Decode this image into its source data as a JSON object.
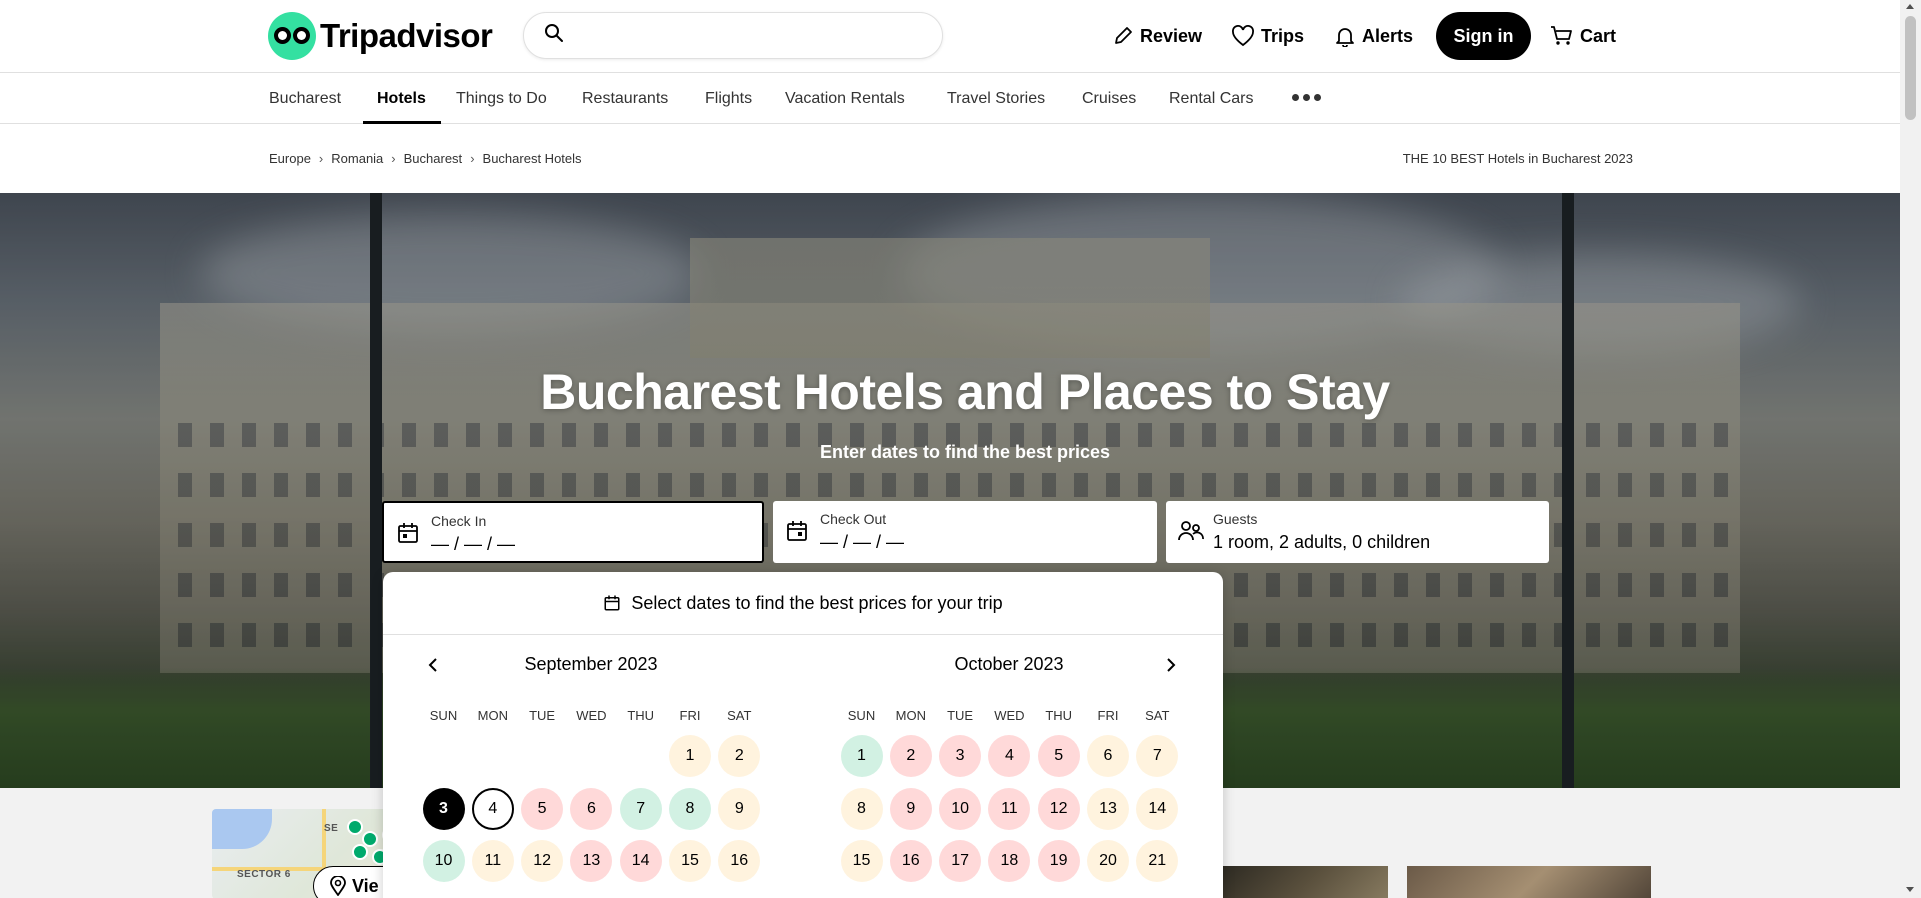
{
  "header": {
    "brand": "Tripadvisor",
    "search": {
      "value": "",
      "placeholder": ""
    },
    "nav": {
      "review": "Review",
      "trips": "Trips",
      "alerts": "Alerts",
      "signin": "Sign in",
      "cart": "Cart"
    }
  },
  "subnav": {
    "items": [
      "Bucharest",
      "Hotels",
      "Things to Do",
      "Restaurants",
      "Flights",
      "Vacation Rentals",
      "Travel Stories",
      "Cruises",
      "Rental Cars"
    ],
    "active": "Hotels"
  },
  "breadcrumbs": {
    "items": [
      "Europe",
      "Romania",
      "Bucharest",
      "Bucharest Hotels"
    ],
    "right_title": "THE 10 BEST Hotels in Bucharest 2023"
  },
  "hero": {
    "title": "Bucharest Hotels and Places to Stay",
    "subtitle": "Enter dates to find the best prices",
    "check_in": {
      "label": "Check In",
      "value": "— / — / —"
    },
    "check_out": {
      "label": "Check Out",
      "value": "— / — / —"
    },
    "guests": {
      "label": "Guests",
      "value": "1 room, 2 adults, 0 children"
    }
  },
  "calendar": {
    "header": "Select dates to find the best prices for your trip",
    "weekdays": [
      "SUN",
      "MON",
      "TUE",
      "WED",
      "THU",
      "FRI",
      "SAT"
    ],
    "price_colors": {
      "high": "#ffd9d9",
      "mid": "#fff3de",
      "low": "#d2f1e3",
      "selected": "#000000"
    },
    "months": [
      {
        "title": "September 2023",
        "weeks": [
          [
            null,
            null,
            null,
            null,
            null,
            {
              "d": "1",
              "t": "mid"
            },
            {
              "d": "2",
              "t": "mid"
            }
          ],
          [
            {
              "d": "3",
              "t": "sel"
            },
            {
              "d": "4",
              "t": "ring"
            },
            {
              "d": "5",
              "t": "high"
            },
            {
              "d": "6",
              "t": "high"
            },
            {
              "d": "7",
              "t": "low"
            },
            {
              "d": "8",
              "t": "low"
            },
            {
              "d": "9",
              "t": "mid"
            }
          ],
          [
            {
              "d": "10",
              "t": "low"
            },
            {
              "d": "11",
              "t": "mid"
            },
            {
              "d": "12",
              "t": "mid"
            },
            {
              "d": "13",
              "t": "high"
            },
            {
              "d": "14",
              "t": "high"
            },
            {
              "d": "15",
              "t": "mid"
            },
            {
              "d": "16",
              "t": "mid"
            }
          ]
        ]
      },
      {
        "title": "October 2023",
        "weeks": [
          [
            {
              "d": "1",
              "t": "low"
            },
            {
              "d": "2",
              "t": "high"
            },
            {
              "d": "3",
              "t": "high"
            },
            {
              "d": "4",
              "t": "high"
            },
            {
              "d": "5",
              "t": "high"
            },
            {
              "d": "6",
              "t": "mid"
            },
            {
              "d": "7",
              "t": "mid"
            }
          ],
          [
            {
              "d": "8",
              "t": "mid"
            },
            {
              "d": "9",
              "t": "high"
            },
            {
              "d": "10",
              "t": "high"
            },
            {
              "d": "11",
              "t": "high"
            },
            {
              "d": "12",
              "t": "high"
            },
            {
              "d": "13",
              "t": "mid"
            },
            {
              "d": "14",
              "t": "mid"
            }
          ],
          [
            {
              "d": "15",
              "t": "mid"
            },
            {
              "d": "16",
              "t": "high"
            },
            {
              "d": "17",
              "t": "high"
            },
            {
              "d": "18",
              "t": "high"
            },
            {
              "d": "19",
              "t": "high"
            },
            {
              "d": "20",
              "t": "mid"
            },
            {
              "d": "21",
              "t": "mid"
            }
          ]
        ]
      }
    ]
  },
  "map": {
    "label_sector6": "SECTOR 6",
    "label_sector": "SE",
    "view_button": "Vie"
  }
}
